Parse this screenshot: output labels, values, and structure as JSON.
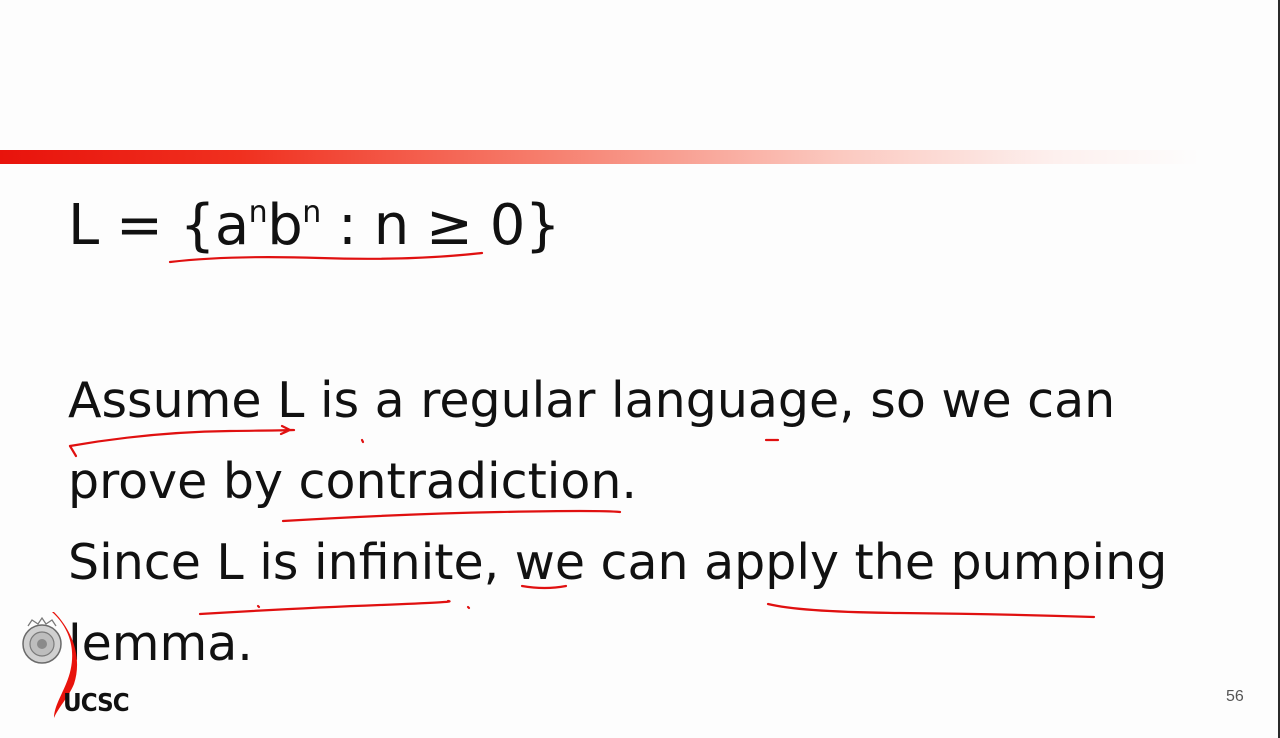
{
  "slide": {
    "set_definition": {
      "prefix": "L = {a",
      "sup1": "n",
      "mid": "b",
      "sup2": "n",
      "suffix": " : n ≥ 0}"
    },
    "lines": [
      "Assume L is a regular language, so we can",
      "prove by contradiction.",
      "Since L is infinite, we can apply the pumping",
      "lemma."
    ],
    "logo_text": "UCSC",
    "page_number": "56",
    "colors": {
      "accent_bar": "#e8130c",
      "annotation_ink": "#e01010"
    }
  }
}
